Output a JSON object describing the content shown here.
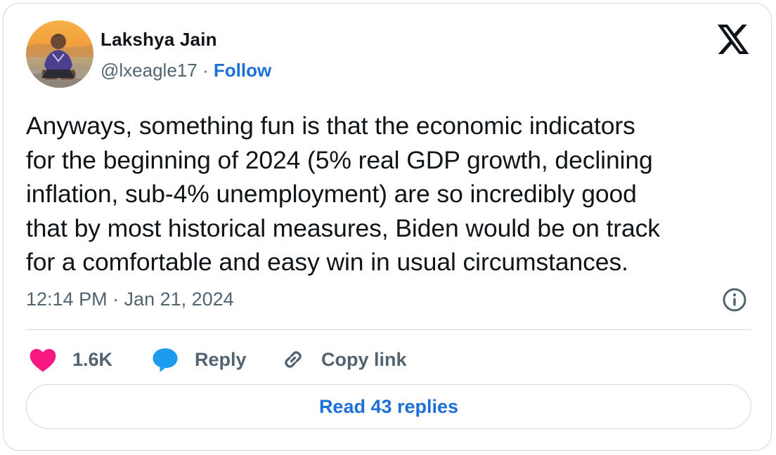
{
  "author": {
    "name": "Lakshya Jain",
    "handle": "@lxeagle17",
    "separator": "·",
    "follow_label": "Follow"
  },
  "tweet": {
    "text": "Anyways, something fun is that the economic indicators\nfor the beginning of 2024 (5% real GDP growth, declining\ninflation, sub-4% unemployment) are so incredibly good\nthat by most historical measures, Biden would be on track\nfor a comfortable and easy win in usual circumstances.",
    "timestamp": "12:14 PM · Jan 21, 2024"
  },
  "actions": {
    "like_count": "1.6K",
    "reply_label": "Reply",
    "copy_link_label": "Copy link"
  },
  "read_replies_label": "Read 43 replies",
  "icons": {
    "brand": "x-logo-icon",
    "info": "info-icon",
    "like": "heart-icon",
    "reply": "speech-bubble-icon",
    "copy": "link-icon"
  },
  "colors": {
    "text": "#0f1419",
    "secondary": "#536471",
    "link": "#1d70d8",
    "like": "#f91880",
    "reply": "#1d9bf0",
    "border": "#cfd9de"
  }
}
